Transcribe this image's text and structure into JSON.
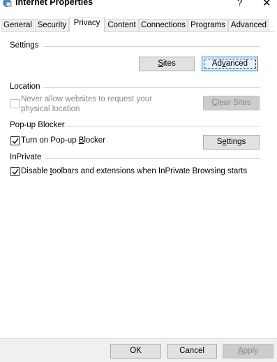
{
  "window": {
    "title": "Internet Properties",
    "help_label": "?",
    "close_label": "✕"
  },
  "tabs": [
    {
      "label": "General",
      "selected": false
    },
    {
      "label": "Security",
      "selected": false
    },
    {
      "label": "Privacy",
      "selected": true
    },
    {
      "label": "Content",
      "selected": false
    },
    {
      "label": "Connections",
      "selected": false
    },
    {
      "label": "Programs",
      "selected": false
    },
    {
      "label": "Advanced",
      "selected": false
    }
  ],
  "settings": {
    "heading": "Settings",
    "sites_button": {
      "pre": "",
      "accel": "S",
      "post": "ites"
    },
    "advanced_button": {
      "pre": "Ad",
      "accel": "v",
      "post": "anced"
    }
  },
  "location": {
    "heading": "Location",
    "never_allow_line1": "Never allow websites to request your",
    "never_allow_line2": "physical location",
    "never_allow_checked": false,
    "clear_sites_button": {
      "pre": "",
      "accel": "C",
      "post": "lear Sites"
    }
  },
  "popup_blocker": {
    "heading": "Pop-up Blocker",
    "turn_on": {
      "pre": "Turn on Pop-up ",
      "accel": "B",
      "post": "locker"
    },
    "turn_on_checked": true,
    "settings_button": {
      "pre": "S",
      "accel": "e",
      "post": "ttings"
    }
  },
  "inprivate": {
    "heading": "InPrivate",
    "disable_toolbars": {
      "pre": "Disable ",
      "accel": "t",
      "post": "oolbars and extensions when InPrivate Browsing starts"
    },
    "disable_toolbars_checked": true
  },
  "footer": {
    "ok_label": "OK",
    "cancel_label": "Cancel",
    "apply_button": {
      "pre": "",
      "accel": "A",
      "post": "pply"
    }
  },
  "colors": {
    "focus_border": "#0078d7",
    "disabled_text": "#8a8a8a"
  }
}
